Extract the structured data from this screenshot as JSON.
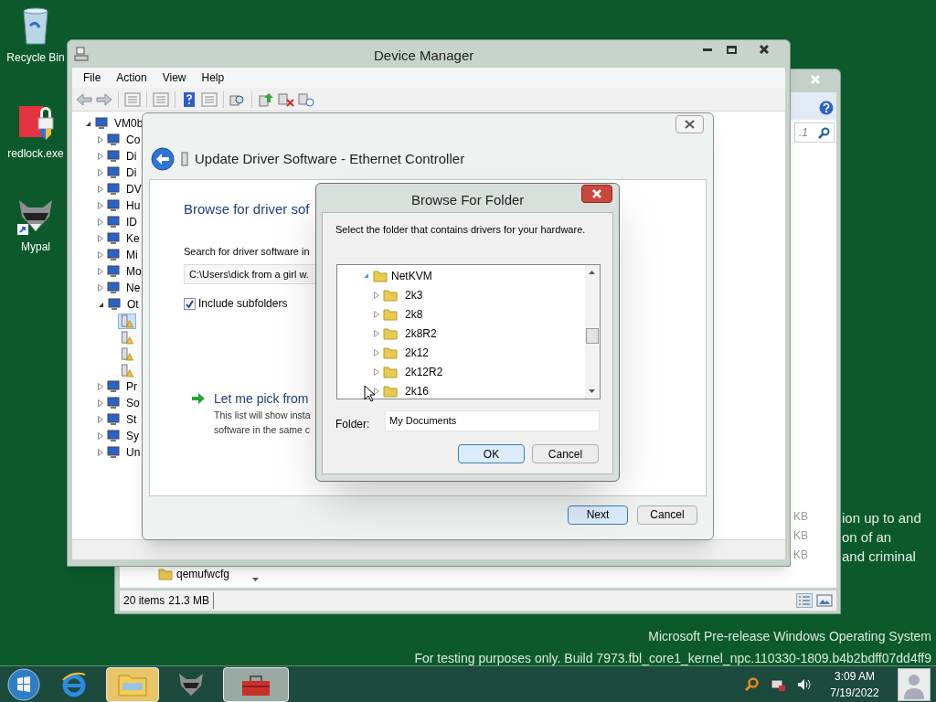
{
  "desktop_icons": [
    {
      "label": "Recycle Bin",
      "kind": "bin"
    },
    {
      "label": "redlock.exe",
      "kind": "lock"
    },
    {
      "label": "Mypal",
      "kind": "raccoon"
    }
  ],
  "desktop_text": [
    "ion up to and",
    "on of an",
    "and criminal"
  ],
  "explorer_window": {
    "search_text": ".1",
    "size_column": [
      "KB",
      "KB",
      "KB"
    ],
    "file": "qemufwcfg",
    "item_count": "20 items",
    "total_size": "21.3 MB"
  },
  "device_manager": {
    "title": "Device Manager",
    "menu": [
      "File",
      "Action",
      "View",
      "Help"
    ],
    "tree": {
      "label": "VM0b",
      "expanded": true,
      "children": [
        {
          "label": "Co",
          "expanded": false
        },
        {
          "label": "Di",
          "expanded": false
        },
        {
          "label": "Di",
          "expanded": false
        },
        {
          "label": "DV",
          "expanded": false
        },
        {
          "label": "Hu",
          "expanded": false
        },
        {
          "label": "ID",
          "expanded": false
        },
        {
          "label": "Ke",
          "expanded": false
        },
        {
          "label": "Mi",
          "expanded": false
        },
        {
          "label": "Mo",
          "expanded": false
        },
        {
          "label": "Ne",
          "expanded": false
        },
        {
          "label": "Ot",
          "expanded": true,
          "children": [
            {
              "selected": true
            },
            {
              "selected": false
            },
            {
              "selected": false
            },
            {
              "selected": false
            }
          ]
        },
        {
          "label": "Pr",
          "expanded": false
        },
        {
          "label": "So",
          "expanded": false
        },
        {
          "label": "St",
          "expanded": false
        },
        {
          "label": "Sy",
          "expanded": false
        },
        {
          "label": "Un",
          "expanded": false
        }
      ]
    }
  },
  "update_driver": {
    "title": "Update Driver Software - Ethernet Controller",
    "heading": "Browse for driver sof",
    "search_label": "Search for driver software in",
    "path": "C:\\Users\\dick from a girl w.",
    "include_subfolders": {
      "label": "Include subfolders",
      "checked": true
    },
    "pick_link": "Let me pick from",
    "pick_desc": [
      "This list will show insta",
      "software in the same c"
    ],
    "buttons": [
      "Next",
      "Cancel"
    ]
  },
  "browse_folder": {
    "title": "Browse For Folder",
    "instruction": "Select the folder that contains drivers for your hardware.",
    "tree": {
      "label": "NetKVM",
      "expanded": true,
      "children": [
        {
          "label": "2k3",
          "expanded": false
        },
        {
          "label": "2k8",
          "expanded": false
        },
        {
          "label": "2k8R2",
          "expanded": false
        },
        {
          "label": "2k12",
          "expanded": false
        },
        {
          "label": "2k12R2",
          "expanded": false
        },
        {
          "label": "2k16",
          "expanded": false
        }
      ]
    },
    "folder_label": "Folder:",
    "folder_value": "My Documents",
    "buttons": [
      "OK",
      "Cancel"
    ]
  },
  "build_info": [
    "Microsoft Pre-release Windows Operating System",
    "For testing purposes only. Build 7973.fbl_core1_kernel_npc.110330-1809.b4b2bdff07dd4ff9"
  ],
  "taskbar": {
    "apps": [
      {
        "kind": "browser",
        "selected": false,
        "running": false
      },
      {
        "kind": "folder",
        "selected": true,
        "running": true
      },
      {
        "kind": "raccoon",
        "selected": false,
        "running": false
      },
      {
        "kind": "toolbox",
        "selected": false,
        "running": true
      }
    ],
    "time": "3:09 AM",
    "date": "7/19/2022"
  }
}
